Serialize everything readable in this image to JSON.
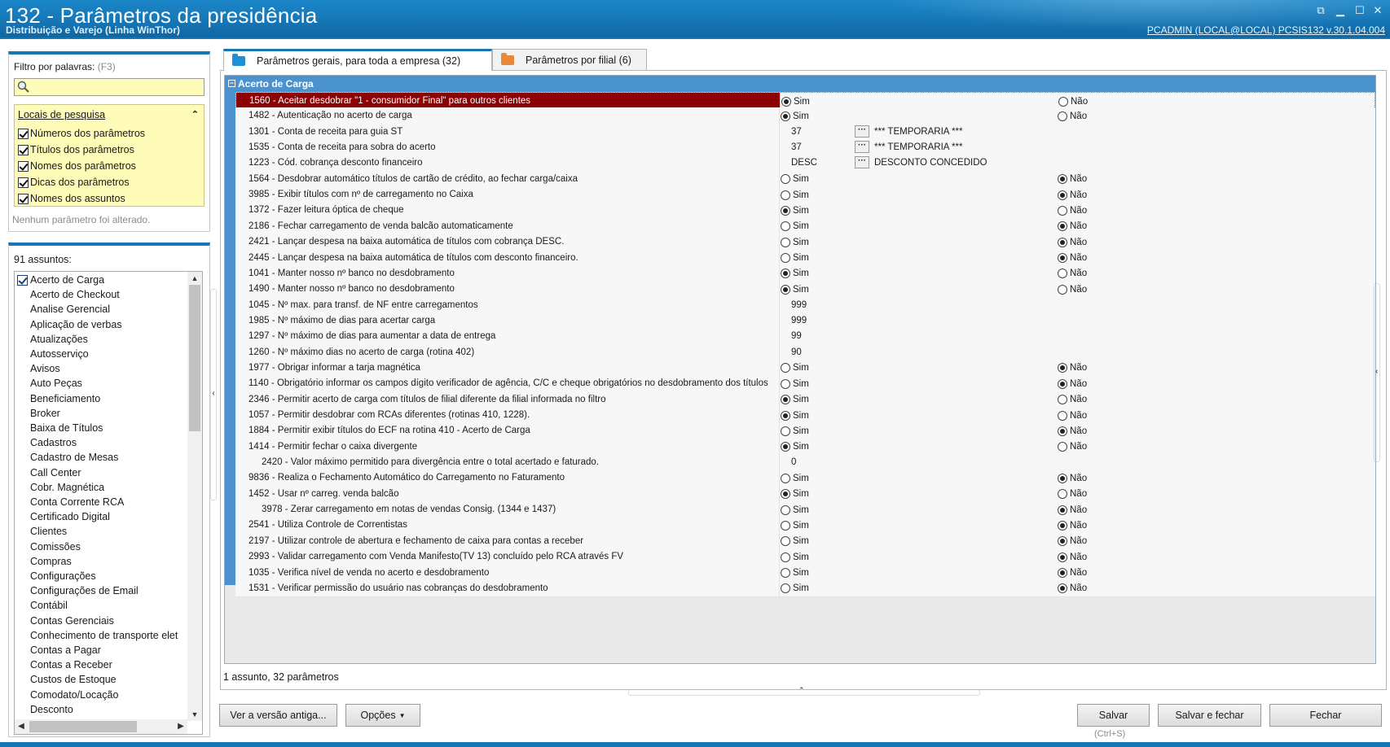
{
  "window": {
    "title": "132 - Parâmetros da presidência",
    "subtitle": "Distribuição e Varejo (Linha WinThor)",
    "session": "PCADMIN (LOCAL@LOCAL)   PCSIS132  v.30.1.04.004"
  },
  "filter": {
    "label": "Filtro por palavras:",
    "hint": "(F3)",
    "search_value": "",
    "locais_title": "Locais de pesquisa",
    "options": [
      {
        "label": "Números dos parâmetros",
        "checked": true
      },
      {
        "label": "Títulos dos parâmetros",
        "checked": true
      },
      {
        "label": "Nomes dos parâmetros",
        "checked": true
      },
      {
        "label": "Dicas dos parâmetros",
        "checked": true
      },
      {
        "label": "Nomes dos assuntos",
        "checked": true
      }
    ],
    "status": "Nenhum parâmetro foi alterado."
  },
  "subjects": {
    "count_label": "91 assuntos:",
    "items": [
      "Acerto de Carga",
      "Acerto de Checkout",
      "Analise Gerencial",
      "Aplicação de verbas",
      "Atualizações",
      "Autosserviço",
      "Avisos",
      "Auto Peças",
      "Beneficiamento",
      "Broker",
      "Baixa de Títulos",
      "Cadastros",
      "Cadastro de Mesas",
      "Call Center",
      "Cobr. Magnética",
      "Conta Corrente RCA",
      "Certificado Digital",
      "Clientes",
      "Comissões",
      "Compras",
      "Configurações",
      "Configurações de Email",
      "Contábil",
      "Contas Gerenciais",
      "Conhecimento de transporte elet",
      "Contas a Pagar",
      "Contas a Receber",
      "Custos de Estoque",
      "Comodato/Locação",
      "Desconto"
    ],
    "checked_index": 0
  },
  "tabs": [
    {
      "label": "Parâmetros gerais, para toda a empresa  (32)",
      "color": "#1f8fd6"
    },
    {
      "label": "Parâmetros por filial  (6)",
      "color": "#e8893a"
    }
  ],
  "group": {
    "title": "Acerto de Carga"
  },
  "labels": {
    "sim": "Sim",
    "nao": "Não"
  },
  "params": [
    {
      "name": "1560 - Aceitar desdobrar \"1 - consumidor Final\" para outros clientes",
      "type": "bool",
      "value": "sim",
      "selected": true
    },
    {
      "name": "1482 - Autenticação no acerto de carga",
      "type": "bool",
      "value": "sim"
    },
    {
      "name": "1301 - Conta de receita para guia ST",
      "type": "lookup",
      "value": "37",
      "desc": "*** TEMPORARIA ***"
    },
    {
      "name": "1535 - Conta de receita para sobra do acerto",
      "type": "lookup",
      "value": "37",
      "desc": "*** TEMPORARIA ***"
    },
    {
      "name": "1223 - Cód. cobrança desconto financeiro",
      "type": "lookup",
      "value": "DESC",
      "desc": "DESCONTO CONCEDIDO"
    },
    {
      "name": "1564 - Desdobrar automático títulos de cartão de crédito, ao fechar carga/caixa",
      "type": "bool",
      "value": "nao"
    },
    {
      "name": "3985 - Exibir títulos com nº de carregamento no Caixa",
      "type": "bool",
      "value": "nao"
    },
    {
      "name": "1372 - Fazer leitura óptica de cheque",
      "type": "bool",
      "value": "sim"
    },
    {
      "name": "2186 - Fechar carregamento de venda balcão automaticamente",
      "type": "bool",
      "value": "nao"
    },
    {
      "name": "2421 - Lançar despesa na baixa automática de títulos com cobrança DESC.",
      "type": "bool",
      "value": "nao"
    },
    {
      "name": "2445 - Lançar despesa na baixa automática de títulos com desconto financeiro.",
      "type": "bool",
      "value": "nao"
    },
    {
      "name": "1041 - Manter nosso nº banco no desdobramento",
      "type": "bool",
      "value": "sim"
    },
    {
      "name": "1490 - Manter nosso nº banco no desdobramento",
      "type": "bool",
      "value": "sim"
    },
    {
      "name": "1045 - Nº max. para transf. de NF entre carregamentos",
      "type": "text",
      "value": "999"
    },
    {
      "name": "1985 - Nº máximo de dias para acertar carga",
      "type": "text",
      "value": "999"
    },
    {
      "name": "1297 - Nº máximo de dias para aumentar a data de entrega",
      "type": "text",
      "value": "99"
    },
    {
      "name": "1260 - Nº máximo dias no acerto de carga (rotina 402)",
      "type": "text",
      "value": "90"
    },
    {
      "name": "1977 - Obrigar informar a tarja magnética",
      "type": "bool",
      "value": "nao"
    },
    {
      "name": "1140 - Obrigatório informar os campos dígito verificador de agência, C/C e cheque obrigatórios no desdobramento dos títulos",
      "type": "bool",
      "value": "nao"
    },
    {
      "name": "2346 - Permitir acerto de carga com títulos de filial diferente da filial informada no filtro",
      "type": "bool",
      "value": "sim"
    },
    {
      "name": "1057 - Permitir desdobrar com RCAs diferentes (rotinas 410, 1228).",
      "type": "bool",
      "value": "sim"
    },
    {
      "name": "1884 - Permitir exibir títulos do ECF na rotina 410 - Acerto de Carga",
      "type": "bool",
      "value": "nao"
    },
    {
      "name": "1414 - Permitir fechar o caixa divergente",
      "type": "bool",
      "value": "sim"
    },
    {
      "name": "2420 - Valor máximo permitido para divergência entre o total acertado e faturado.",
      "type": "text",
      "value": "0",
      "indent": true
    },
    {
      "name": "9836 - Realiza o Fechamento Automático do Carregamento no Faturamento",
      "type": "bool",
      "value": "nao"
    },
    {
      "name": "1452 - Usar nº carreg. venda balcão",
      "type": "bool",
      "value": "sim"
    },
    {
      "name": "3978 - Zerar carregamento em notas de vendas Consig. (1344 e 1437)",
      "type": "bool",
      "value": "nao",
      "indent": true
    },
    {
      "name": "2541 - Utiliza Controle de Correntistas",
      "type": "bool",
      "value": "nao"
    },
    {
      "name": "2197 - Utilizar controle de abertura e fechamento de caixa para contas a receber",
      "type": "bool",
      "value": "nao"
    },
    {
      "name": "2993 - Validar carregamento com Venda Manifesto(TV 13) concluído pelo RCA através FV",
      "type": "bool",
      "value": "nao"
    },
    {
      "name": "1035 - Verifica nível de venda no acerto e desdobramento",
      "type": "bool",
      "value": "nao"
    },
    {
      "name": "1531 - Verificar permissão do usuário nas cobranças do desdobramento",
      "type": "bool",
      "value": "nao"
    }
  ],
  "summary": "1 assunto, 32 parâmetros",
  "buttons": {
    "old_version": "Ver a versão antiga...",
    "options": "Opções",
    "save": "Salvar",
    "save_shortcut": "(Ctrl+S)",
    "save_close": "Salvar e fechar",
    "close": "Fechar"
  }
}
